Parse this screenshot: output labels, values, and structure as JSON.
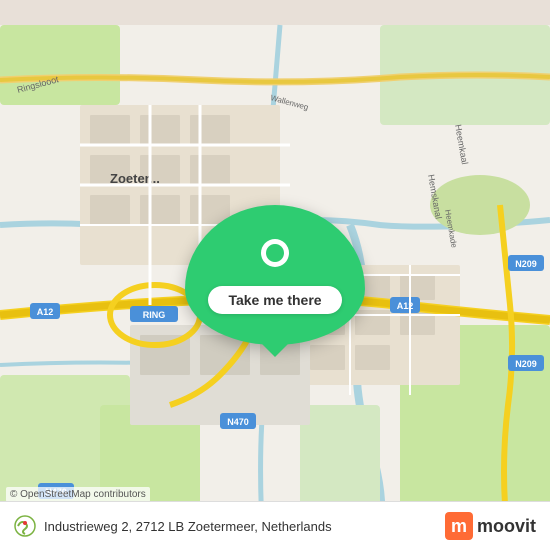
{
  "map": {
    "center_lat": 52.04,
    "center_lon": 4.47,
    "bg_color": "#e8dfd0"
  },
  "overlay": {
    "cta_label": "Take me there",
    "pin_symbol": "📍"
  },
  "info_bar": {
    "address": "Industrieweg 2, 2712 LB Zoetermeer, Netherlands",
    "attribution": "© OpenStreetMap contributors",
    "moovit_brand": "moovit"
  }
}
